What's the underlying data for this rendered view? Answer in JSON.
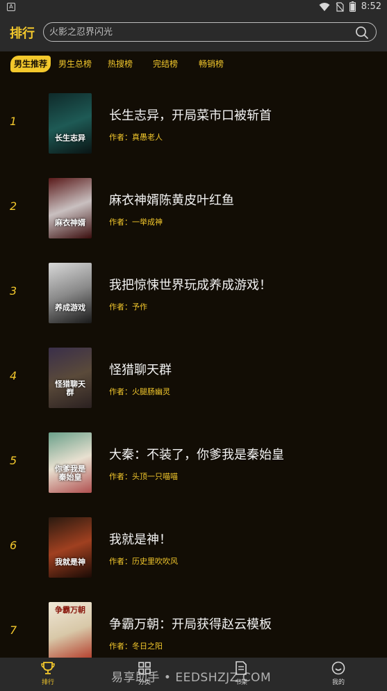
{
  "status_bar": {
    "app_icon_text": "A",
    "time": "8:52"
  },
  "header": {
    "title": "排行"
  },
  "search": {
    "placeholder": "火影之忍界闪光"
  },
  "tabs": [
    {
      "label": "男生推荐",
      "active": true
    },
    {
      "label": "男生总榜",
      "active": false
    },
    {
      "label": "热搜榜",
      "active": false
    },
    {
      "label": "完结榜",
      "active": false
    },
    {
      "label": "畅销榜",
      "active": false
    }
  ],
  "books": [
    {
      "rank": "1",
      "title": "长生志异，开局菜市口被斩首",
      "author": "作者：真愚老人",
      "cover_text": "长生志异",
      "cover_colors": [
        "#0f2a2a",
        "#1e5a55",
        "#0a1414"
      ]
    },
    {
      "rank": "2",
      "title": "麻衣神婿陈黄皮叶红鱼",
      "author": "作者：一举成神",
      "cover_text": "麻衣神婿",
      "cover_colors": [
        "#5a1a1a",
        "#c9c0c0",
        "#3a0d0d"
      ]
    },
    {
      "rank": "3",
      "title": "我把惊悚世界玩成养成游戏！",
      "author": "作者：予作",
      "cover_text": "养成游戏",
      "cover_colors": [
        "#d8d8d8",
        "#8a8a8a",
        "#1a1a1a"
      ]
    },
    {
      "rank": "4",
      "title": "怪猎聊天群",
      "author": "作者：火腿肠幽灵",
      "cover_text": "怪猎聊天群",
      "cover_colors": [
        "#3a2f4a",
        "#5a4a3a",
        "#2a2020"
      ]
    },
    {
      "rank": "5",
      "title": "大秦：不装了，你爹我是秦始皇",
      "author": "作者：头顶一只喵喵",
      "cover_text": "你爹我是秦始皇",
      "cover_colors": [
        "#6aa08a",
        "#e8e0d0",
        "#b05050"
      ]
    },
    {
      "rank": "6",
      "title": "我就是神！",
      "author": "作者：历史里吹吹风",
      "cover_text": "我就是神",
      "cover_colors": [
        "#2a1a10",
        "#a04020",
        "#1a0a05"
      ]
    },
    {
      "rank": "7",
      "title": "争霸万朝：开局获得赵云模板",
      "author": "作者：冬日之阳",
      "cover_text": "争霸万朝",
      "cover_colors": [
        "#f0e8d8",
        "#d8c8a8",
        "#b03020"
      ]
    }
  ],
  "bottom_nav": [
    {
      "label": "排行",
      "icon": "trophy-icon",
      "active": true
    },
    {
      "label": "分类",
      "icon": "grid-icon",
      "active": false
    },
    {
      "label": "书架",
      "icon": "bookshelf-icon",
      "active": false
    },
    {
      "label": "我的",
      "icon": "profile-icon",
      "active": false
    }
  ],
  "watermark": "易享助手 • EEDSHZJZ.COM",
  "colors": {
    "accent": "#f3c82c",
    "background": "#120d05",
    "bar": "#2a2a2a"
  }
}
